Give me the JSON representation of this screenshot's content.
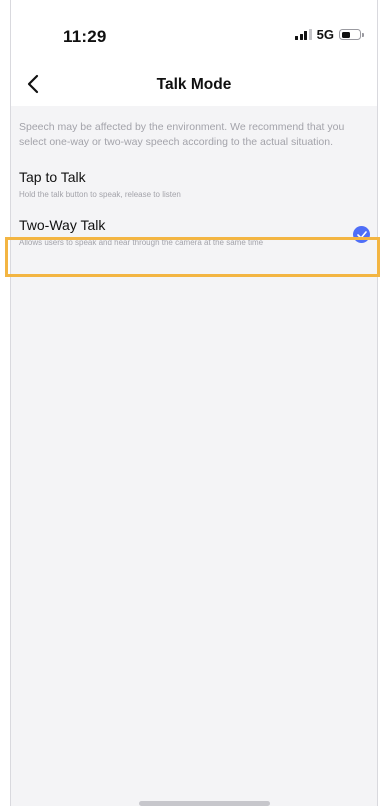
{
  "status_bar": {
    "time": "11:29",
    "network": "5G"
  },
  "nav": {
    "title": "Talk Mode",
    "back_icon": "chevron-left-icon"
  },
  "notice": "Speech may be affected by the environment. We recommend that you select one-way or two-way speech according to the actual situation.",
  "options": [
    {
      "title": "Tap to Talk",
      "description": "Hold the talk button to speak, release to listen",
      "selected": false
    },
    {
      "title": "Two-Way Talk",
      "description": "Allows users to speak and hear through the camera at the same time",
      "selected": true
    }
  ],
  "colors": {
    "accent": "#4f6ef7",
    "highlight_border": "#f3b542",
    "background": "#f4f4f6"
  }
}
